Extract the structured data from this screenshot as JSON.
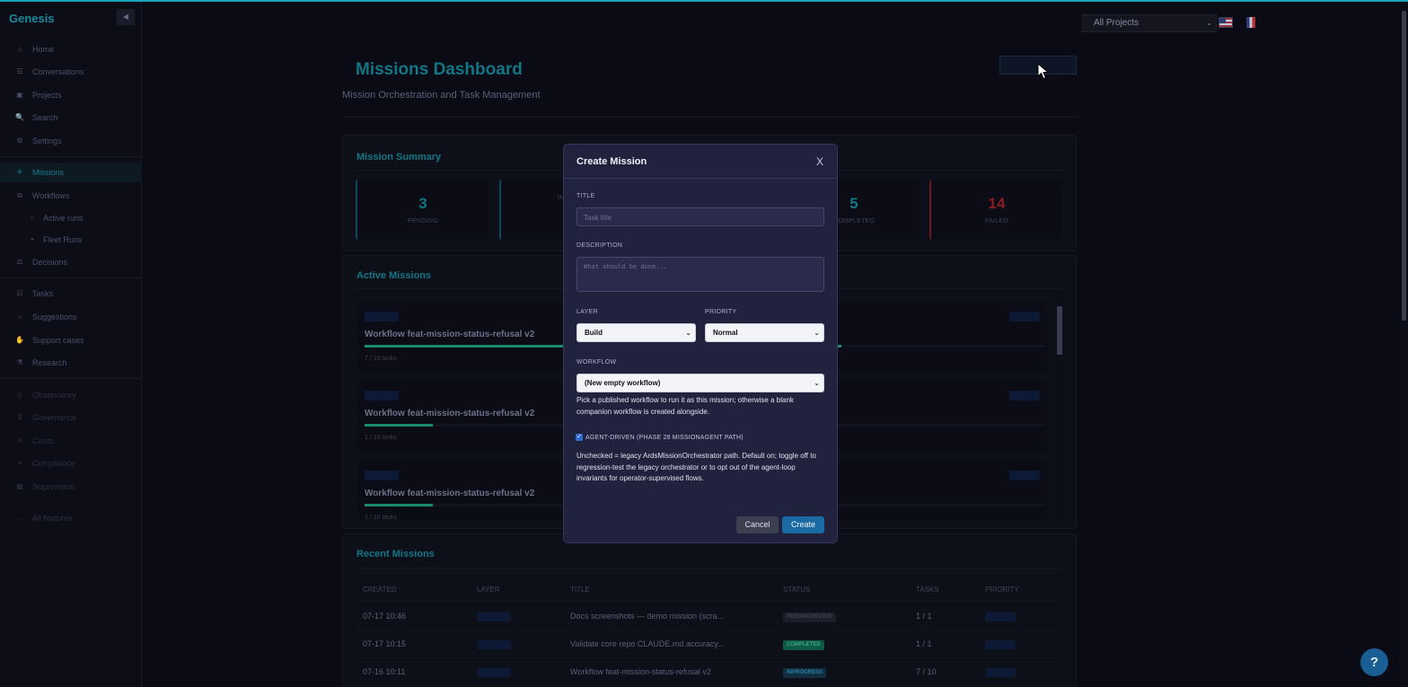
{
  "app": {
    "brand": "Genesis",
    "collapse_icon": "◀"
  },
  "sidebar": {
    "items": [
      {
        "label": "Home",
        "icon": "⌂"
      },
      {
        "label": "Conversations",
        "icon": "☰"
      },
      {
        "label": "Projects",
        "icon": "▣"
      },
      {
        "label": "Search",
        "icon": "🔍"
      },
      {
        "label": "Settings",
        "icon": "⚙"
      },
      {
        "label": "Missions",
        "icon": "✈"
      },
      {
        "label": "Workflows",
        "icon": "⧉"
      },
      {
        "label": "Active runs",
        "icon": "○"
      },
      {
        "label": "Fleet Runs",
        "icon": "+"
      },
      {
        "label": "Decisions",
        "icon": "⚖"
      },
      {
        "label": "Tasks",
        "icon": "☑"
      },
      {
        "label": "Suggestions",
        "icon": "☼"
      },
      {
        "label": "Support cases",
        "icon": "✋"
      },
      {
        "label": "Research",
        "icon": "⚗"
      },
      {
        "label": "Observatory",
        "icon": "◎"
      },
      {
        "label": "Governance",
        "icon": "$"
      },
      {
        "label": "Costs",
        "icon": "¤"
      },
      {
        "label": "Compliance",
        "icon": "≡"
      },
      {
        "label": "Supervision",
        "icon": "▦"
      },
      {
        "label": "All features",
        "icon": "…"
      }
    ]
  },
  "topbar": {
    "project_select": "All Projects"
  },
  "header": {
    "title": "Missions Dashboard",
    "subtitle": "Mission Orchestration and Task Management"
  },
  "summary": {
    "title": "Mission Summary",
    "stats": [
      {
        "value": "3",
        "label": "PENDING"
      },
      {
        "value": "",
        "label": "IN PR"
      },
      {
        "value": "5",
        "label": "COMPLETED"
      },
      {
        "value": "14",
        "label": "FAILED"
      }
    ]
  },
  "active": {
    "title": "Active Missions",
    "missions": [
      {
        "title": "Workflow feat-mission-status-refusal v2",
        "tasks": "7 / 10 tasks",
        "progress": 0.7
      },
      {
        "title": "Workflow feat-mission-status-refusal v2",
        "tasks": "1 / 10 tasks",
        "progress": 0.1
      },
      {
        "title": "Workflow feat-mission-status-refusal v2",
        "tasks": "1 / 10 tasks",
        "progress": 0.1
      }
    ]
  },
  "recent": {
    "title": "Recent Missions",
    "columns": [
      "CREATED",
      "LAYER",
      "TITLE",
      "STATUS",
      "TASKS",
      "PRIORITY"
    ],
    "rows": [
      {
        "created": "07-17 10:46",
        "title": "Docs screenshots — demo mission (scra...",
        "status": "PENDINGREVIEW",
        "tasks": "1 / 1"
      },
      {
        "created": "07-17 10:15",
        "title": "Validate core repo CLAUDE.md accuracy...",
        "status": "COMPLETED",
        "tasks": "1 / 1"
      },
      {
        "created": "07-16 10:11",
        "title": "Workflow feat-mission-status-refusal v2",
        "status": "INPROGRESS",
        "tasks": "7 / 10"
      }
    ]
  },
  "modal": {
    "title": "Create Mission",
    "close": "X",
    "title_label": "TITLE",
    "title_placeholder": "Task title",
    "description_label": "DESCRIPTION",
    "description_placeholder": "What should be done...",
    "layer_label": "LAYER",
    "layer_value": "Build",
    "priority_label": "PRIORITY",
    "priority_value": "Normal",
    "workflow_label": "WORKFLOW",
    "workflow_value": "(New empty workflow)",
    "workflow_help": "Pick a published workflow to run it as this mission; otherwise a blank companion workflow is created alongside.",
    "agent_label": "AGENT-DRIVEN (PHASE 28 MISSIONAGENT PATH)",
    "agent_help": "Unchecked = legacy ArdsMissionOrchestrator path. Default on; toggle off to regression-test the legacy orchestrator or to opt out of the agent-loop invariants for operator-supervised flows.",
    "cancel": "Cancel",
    "create": "Create"
  },
  "help": "?",
  "colors": {
    "accent": "#137685",
    "primary_button": "#1a6aa3",
    "modal_bg": "#21223d"
  }
}
